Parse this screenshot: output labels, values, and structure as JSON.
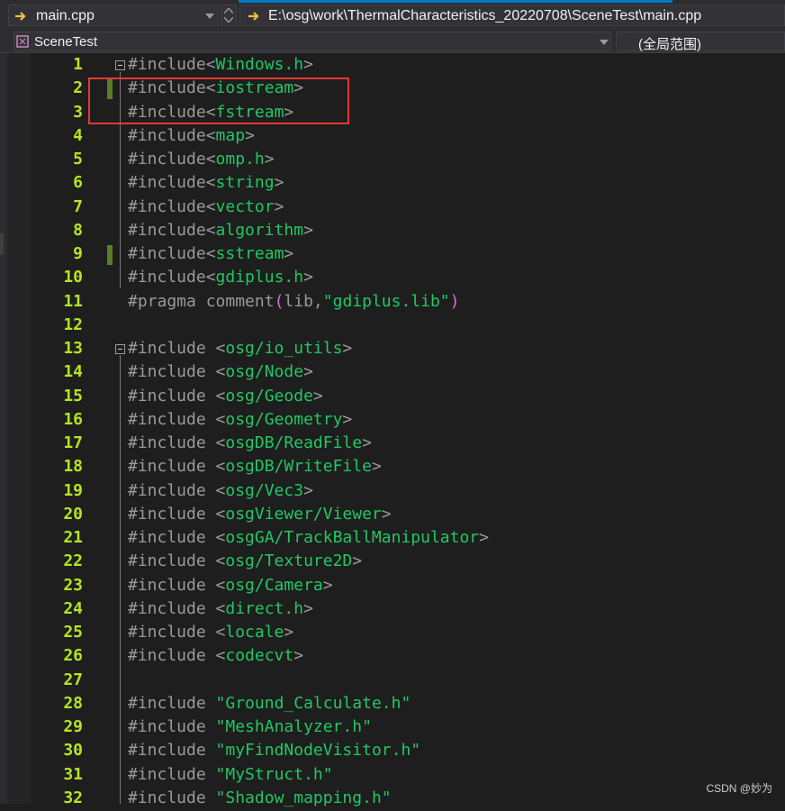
{
  "nav": {
    "file_combo": "main.cpp",
    "path_combo": "E:\\osg\\work\\ThermalCharacteristics_20220708\\SceneTest\\main.cpp",
    "project_combo": "SceneTest",
    "scope_combo": "(全局范围)"
  },
  "colors": {
    "background": "#1e1e1e",
    "line_number": "#b5e61d",
    "include_path": "#21c764",
    "preprocessor": "#9a9a9a",
    "string": "#d69d85",
    "paren": "#da70d6",
    "change_marker": "#5a7d2a",
    "highlight_box": "#e53935"
  },
  "editor": {
    "lines": [
      {
        "n": "1",
        "tokens": [
          {
            "t": "#include<",
            "c": "pp"
          },
          {
            "t": "Windows.h",
            "c": "inc"
          },
          {
            "t": ">",
            "c": "pp"
          }
        ]
      },
      {
        "n": "2",
        "tokens": [
          {
            "t": "#include<",
            "c": "pp"
          },
          {
            "t": "iostream",
            "c": "inc"
          },
          {
            "t": ">",
            "c": "pp"
          }
        ]
      },
      {
        "n": "3",
        "tokens": [
          {
            "t": "#include<",
            "c": "pp"
          },
          {
            "t": "fstream",
            "c": "inc"
          },
          {
            "t": ">",
            "c": "pp"
          }
        ]
      },
      {
        "n": "4",
        "tokens": [
          {
            "t": "#include<",
            "c": "pp"
          },
          {
            "t": "map",
            "c": "inc"
          },
          {
            "t": ">",
            "c": "pp"
          }
        ]
      },
      {
        "n": "5",
        "tokens": [
          {
            "t": "#include<",
            "c": "pp"
          },
          {
            "t": "omp.h",
            "c": "inc"
          },
          {
            "t": ">",
            "c": "pp"
          }
        ]
      },
      {
        "n": "6",
        "tokens": [
          {
            "t": "#include<",
            "c": "pp"
          },
          {
            "t": "string",
            "c": "inc"
          },
          {
            "t": ">",
            "c": "pp"
          }
        ]
      },
      {
        "n": "7",
        "tokens": [
          {
            "t": "#include<",
            "c": "pp"
          },
          {
            "t": "vector",
            "c": "inc"
          },
          {
            "t": ">",
            "c": "pp"
          }
        ]
      },
      {
        "n": "8",
        "tokens": [
          {
            "t": "#include<",
            "c": "pp"
          },
          {
            "t": "algorithm",
            "c": "inc"
          },
          {
            "t": ">",
            "c": "pp"
          }
        ]
      },
      {
        "n": "9",
        "tokens": [
          {
            "t": "#include<",
            "c": "pp"
          },
          {
            "t": "sstream",
            "c": "inc"
          },
          {
            "t": ">",
            "c": "pp"
          }
        ]
      },
      {
        "n": "10",
        "tokens": [
          {
            "t": "#include<",
            "c": "pp"
          },
          {
            "t": "gdiplus.h",
            "c": "inc"
          },
          {
            "t": ">",
            "c": "pp"
          }
        ]
      },
      {
        "n": "11",
        "tokens": [
          {
            "t": "#pragma comment",
            "c": "pp"
          },
          {
            "t": "(",
            "c": "paren"
          },
          {
            "t": "lib,",
            "c": "pp"
          },
          {
            "t": "\"gdiplus.lib\"",
            "c": "inc"
          },
          {
            "t": ")",
            "c": "paren"
          }
        ]
      },
      {
        "n": "12",
        "tokens": []
      },
      {
        "n": "13",
        "tokens": [
          {
            "t": "#include <",
            "c": "pp"
          },
          {
            "t": "osg/io_utils",
            "c": "inc"
          },
          {
            "t": ">",
            "c": "pp"
          }
        ]
      },
      {
        "n": "14",
        "tokens": [
          {
            "t": "#include <",
            "c": "pp"
          },
          {
            "t": "osg/Node",
            "c": "inc"
          },
          {
            "t": ">",
            "c": "pp"
          }
        ]
      },
      {
        "n": "15",
        "tokens": [
          {
            "t": "#include <",
            "c": "pp"
          },
          {
            "t": "osg/Geode",
            "c": "inc"
          },
          {
            "t": ">",
            "c": "pp"
          }
        ]
      },
      {
        "n": "16",
        "tokens": [
          {
            "t": "#include <",
            "c": "pp"
          },
          {
            "t": "osg/Geometry",
            "c": "inc"
          },
          {
            "t": ">",
            "c": "pp"
          }
        ]
      },
      {
        "n": "17",
        "tokens": [
          {
            "t": "#include <",
            "c": "pp"
          },
          {
            "t": "osgDB/ReadFile",
            "c": "inc"
          },
          {
            "t": ">",
            "c": "pp"
          }
        ]
      },
      {
        "n": "18",
        "tokens": [
          {
            "t": "#include <",
            "c": "pp"
          },
          {
            "t": "osgDB/WriteFile",
            "c": "inc"
          },
          {
            "t": ">",
            "c": "pp"
          }
        ]
      },
      {
        "n": "19",
        "tokens": [
          {
            "t": "#include <",
            "c": "pp"
          },
          {
            "t": "osg/Vec3",
            "c": "inc"
          },
          {
            "t": ">",
            "c": "pp"
          }
        ]
      },
      {
        "n": "20",
        "tokens": [
          {
            "t": "#include <",
            "c": "pp"
          },
          {
            "t": "osgViewer/Viewer",
            "c": "inc"
          },
          {
            "t": ">",
            "c": "pp"
          }
        ]
      },
      {
        "n": "21",
        "tokens": [
          {
            "t": "#include <",
            "c": "pp"
          },
          {
            "t": "osgGA/TrackBallManipulator",
            "c": "inc"
          },
          {
            "t": ">",
            "c": "pp"
          }
        ]
      },
      {
        "n": "22",
        "tokens": [
          {
            "t": "#include <",
            "c": "pp"
          },
          {
            "t": "osg/Texture2D",
            "c": "inc"
          },
          {
            "t": ">",
            "c": "pp"
          }
        ]
      },
      {
        "n": "23",
        "tokens": [
          {
            "t": "#include <",
            "c": "pp"
          },
          {
            "t": "osg/Camera",
            "c": "inc"
          },
          {
            "t": ">",
            "c": "pp"
          }
        ]
      },
      {
        "n": "24",
        "tokens": [
          {
            "t": "#include <",
            "c": "pp"
          },
          {
            "t": "direct.h",
            "c": "inc"
          },
          {
            "t": ">",
            "c": "pp"
          }
        ]
      },
      {
        "n": "25",
        "tokens": [
          {
            "t": "#include <",
            "c": "pp"
          },
          {
            "t": "locale",
            "c": "inc"
          },
          {
            "t": ">",
            "c": "pp"
          }
        ]
      },
      {
        "n": "26",
        "tokens": [
          {
            "t": "#include <",
            "c": "pp"
          },
          {
            "t": "codecvt",
            "c": "inc"
          },
          {
            "t": ">",
            "c": "pp"
          }
        ]
      },
      {
        "n": "27",
        "tokens": []
      },
      {
        "n": "28",
        "tokens": [
          {
            "t": "#include ",
            "c": "pp"
          },
          {
            "t": "\"Ground_Calculate.h\"",
            "c": "inc"
          }
        ]
      },
      {
        "n": "29",
        "tokens": [
          {
            "t": "#include ",
            "c": "pp"
          },
          {
            "t": "\"MeshAnalyzer.h\"",
            "c": "inc"
          }
        ]
      },
      {
        "n": "30",
        "tokens": [
          {
            "t": "#include ",
            "c": "pp"
          },
          {
            "t": "\"myFindNodeVisitor.h\"",
            "c": "inc"
          }
        ]
      },
      {
        "n": "31",
        "tokens": [
          {
            "t": "#include ",
            "c": "pp"
          },
          {
            "t": "\"MyStruct.h\"",
            "c": "inc"
          }
        ]
      },
      {
        "n": "32",
        "tokens": [
          {
            "t": "#include ",
            "c": "pp"
          },
          {
            "t": "\"Shadow_mapping.h\"",
            "c": "inc"
          }
        ]
      }
    ]
  },
  "watermark": "CSDN @妙为"
}
